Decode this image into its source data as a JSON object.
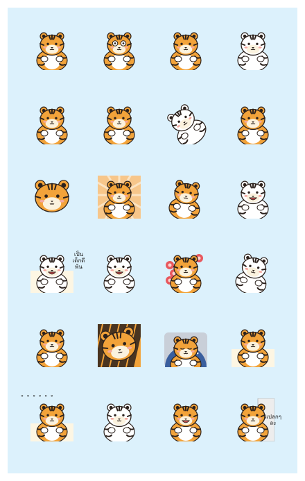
{
  "colors": {
    "background": "#dcf1fc",
    "tiger_orange": "#f2a33a",
    "tiger_stripe": "#2b211c",
    "tiger_cream": "#fbf2de",
    "tiger_white": "#ffffff",
    "blush": "#f4a9a0",
    "paper": "#fdf6e3",
    "flowers": "#e8585e",
    "night_blue": "#3a5f9e"
  },
  "stickers": [
    {
      "icon": "tiger-hug-icon",
      "caption": ""
    },
    {
      "icon": "tiger-shocked-icon",
      "caption": ""
    },
    {
      "icon": "tiger-lying-stripes-icon",
      "caption": ""
    },
    {
      "icon": "white-tiger-wave-icon",
      "caption": ""
    },
    {
      "icon": "tiger-lying-side-icon",
      "caption": ""
    },
    {
      "icon": "tiger-standing-icon",
      "caption": ""
    },
    {
      "icon": "tiger-rolling-icon",
      "caption": ""
    },
    {
      "icon": "tiger-pointing-icon",
      "caption": ""
    },
    {
      "icon": "tiger-peek-icon",
      "caption": ""
    },
    {
      "icon": "tiger-sunburst-icon",
      "caption": ""
    },
    {
      "icon": "tiger-jumping-icon",
      "caption": ""
    },
    {
      "icon": "white-tiger-cheer-icon",
      "caption": ""
    },
    {
      "icon": "tiger-writing-icon",
      "caption": "เป็น\nเด็กดี\nพ้น"
    },
    {
      "icon": "white-tiger-grin-icon",
      "caption": ""
    },
    {
      "icon": "tiger-flowers-icon",
      "caption": ""
    },
    {
      "icon": "white-tiger-dance-icon",
      "caption": ""
    },
    {
      "icon": "tiger-sitting-icon",
      "caption": ""
    },
    {
      "icon": "tiger-closeup-icon",
      "caption": ""
    },
    {
      "icon": "tiger-sleeping-icon",
      "caption": ""
    },
    {
      "icon": "tiger-desk-icon",
      "caption": ""
    },
    {
      "icon": "tiger-dots-icon",
      "caption": "° ° ° ° ° °"
    },
    {
      "icon": "tiger-bite-icon",
      "caption": ""
    },
    {
      "icon": "tiger-smile-icon",
      "caption": ""
    },
    {
      "icon": "tiger-sign-icon",
      "caption": "แปลกๆ\nละ"
    }
  ]
}
